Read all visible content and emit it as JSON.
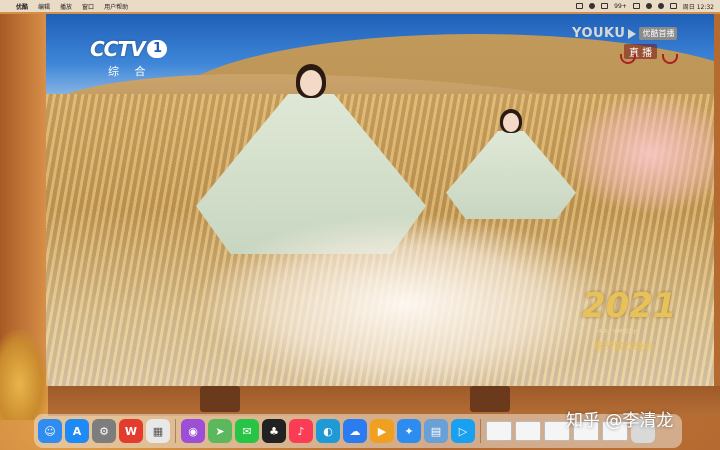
{
  "menubar": {
    "app_name": "优酷",
    "menus": [
      "编辑",
      "播放",
      "窗口",
      "用户帮助"
    ],
    "battery": "99+",
    "datetime": "周日 12:32"
  },
  "video": {
    "channel_logo": "CCTV",
    "channel_number": "1",
    "channel_name": "综 合",
    "youku_text": "YOUKU",
    "youku_badge": "优酷首播",
    "live_label": "直 播",
    "gala_year": "2021",
    "gala_sub1": "中央广播电视总台",
    "gala_sub2": "春节联欢晚会"
  },
  "dock": {
    "icons": [
      {
        "name": "finder-icon",
        "color": "#2f8cf0",
        "glyph": "☺"
      },
      {
        "name": "app-store-icon",
        "color": "#1d8af5",
        "glyph": "A"
      },
      {
        "name": "system-preferences-icon",
        "color": "#7d7d7d",
        "glyph": "⚙"
      },
      {
        "name": "wps-icon",
        "color": "#e33b2e",
        "glyph": "W"
      },
      {
        "name": "launchpad-icon",
        "color": "#e8e8e8",
        "glyph": "▦"
      },
      {
        "name": "podcasts-icon",
        "color": "#9c4fd6",
        "glyph": "◉"
      },
      {
        "name": "maps-icon",
        "color": "#5cb85c",
        "glyph": "➤"
      },
      {
        "name": "wechat-icon",
        "color": "#28c445",
        "glyph": "✉"
      },
      {
        "name": "qq-icon",
        "color": "#222222",
        "glyph": "♣"
      },
      {
        "name": "music-icon",
        "color": "#fa3c55",
        "glyph": "♪"
      },
      {
        "name": "edge-icon",
        "color": "#1f9ad6",
        "glyph": "◐"
      },
      {
        "name": "baidu-netdisk-icon",
        "color": "#2b7cf0",
        "glyph": "☁"
      },
      {
        "name": "infuse-icon",
        "color": "#f0a020",
        "glyph": "▶"
      },
      {
        "name": "safari-icon",
        "color": "#2d8cf0",
        "glyph": "✦"
      },
      {
        "name": "preview-icon",
        "color": "#6aa0d8",
        "glyph": "▤"
      },
      {
        "name": "youku-icon",
        "color": "#1aa0f0",
        "glyph": "▷"
      }
    ],
    "thumbnails_count": 5,
    "trash_label": ""
  },
  "watermark": "知乎 @李清龙",
  "colors": {
    "accent": "#1b5fb0",
    "gala_gold": "#e7c25b"
  }
}
